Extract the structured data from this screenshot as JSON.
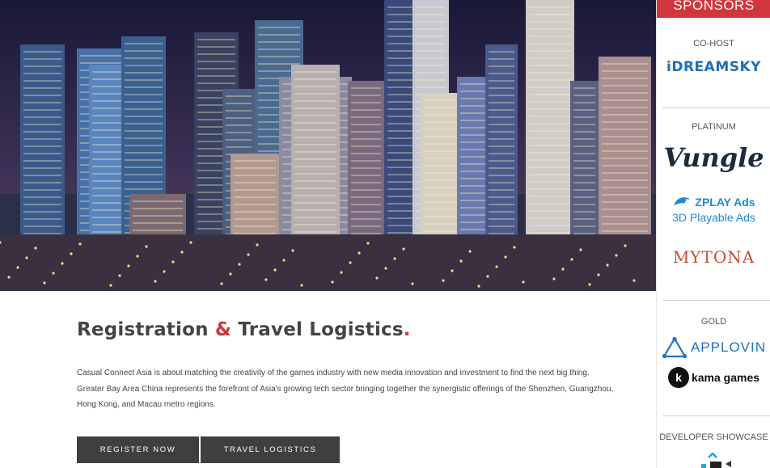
{
  "hero": {
    "image": "night city skyline"
  },
  "main": {
    "headline_part1": "Registration",
    "headline_amp": "&",
    "headline_part2": "Travel Logistics",
    "headline_dot": ".",
    "description": "Casual Connect Asia is about matching the creativity of the games industry with new media innovation and investment to find the next big thing. Greater Bay Area China represents the forefront of Asia's growing tech sector bringing together the synergistic offerings of the Shenzhen, Guangzhou, Hong Kong, and Macau metro regions.",
    "buttons": {
      "register": "REGISTER NOW",
      "travel": "TRAVEL LOGISTICS"
    }
  },
  "sponsors": {
    "title": "SPONSORS",
    "cohost": {
      "label": "CO-HOST",
      "logos": [
        "iDREAMSKY"
      ]
    },
    "platinum": {
      "label": "PLATINUM",
      "logos": [
        "Vungle",
        "ZPLAY Ads",
        "3D Playable Ads",
        "MYTONA"
      ]
    },
    "gold": {
      "label": "GOLD",
      "logos": [
        "APPLOVIN",
        "kama games"
      ]
    },
    "showcase": {
      "label": "DEVELOPER SHOWCASE"
    }
  },
  "colors": {
    "accent": "#d0363c",
    "button": "#3f3f3f",
    "dreamsky": "#1f6fb7",
    "zplay": "#1e88d8",
    "applovin": "#1e73be"
  }
}
